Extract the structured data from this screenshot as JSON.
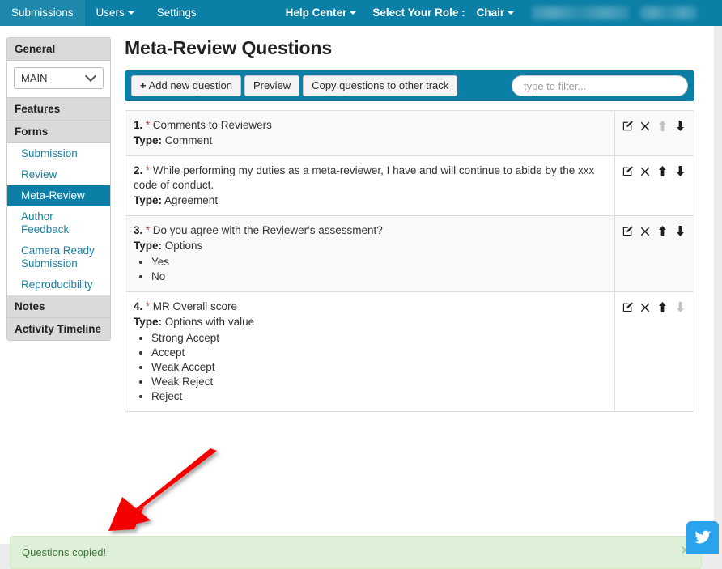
{
  "navbar": {
    "background": "#0b7fa5",
    "left_items": [
      {
        "label": "Submissions",
        "caret": false
      },
      {
        "label": "Users",
        "caret": true
      },
      {
        "label": "Settings",
        "caret": false
      }
    ],
    "help_center": "Help Center",
    "role_label": "Select Your Role :",
    "role_value": "Chair",
    "redacted_items": [
      "",
      ""
    ]
  },
  "sidebar": {
    "general_heading": "General",
    "track_select": {
      "value": "MAIN",
      "options": [
        "MAIN"
      ]
    },
    "features_heading": "Features",
    "forms_heading": "Forms",
    "forms_items": [
      {
        "label": "Submission",
        "active": false
      },
      {
        "label": "Review",
        "active": false
      },
      {
        "label": "Meta-Review",
        "active": true
      },
      {
        "label": "Author Feedback",
        "active": false
      },
      {
        "label": "Camera Ready Submission",
        "active": false
      },
      {
        "label": "Reproducibility",
        "active": false
      }
    ],
    "notes_heading": "Notes",
    "activity_heading": "Activity Timeline"
  },
  "main": {
    "title": "Meta-Review Questions",
    "toolbar": {
      "add_label": "Add new question",
      "add_plus": "+",
      "preview_label": "Preview",
      "copy_label": "Copy questions to other track",
      "filter_placeholder": "type to filter...",
      "filter_value": ""
    },
    "type_label": "Type:",
    "required_marker": "*",
    "questions": [
      {
        "number": "1.",
        "required": true,
        "text": "Comments to Reviewers",
        "type": "Comment",
        "options": [],
        "can_move_up": false,
        "can_move_down": true
      },
      {
        "number": "2.",
        "required": true,
        "text": "While performing my duties as a meta-reviewer, I have and will continue to abide by the xxx code of conduct.",
        "type": "Agreement",
        "options": [],
        "can_move_up": true,
        "can_move_down": true
      },
      {
        "number": "3.",
        "required": true,
        "text": "Do you agree with the Reviewer's assessment?",
        "type": "Options",
        "options": [
          "Yes",
          "No"
        ],
        "can_move_up": true,
        "can_move_down": true
      },
      {
        "number": "4.",
        "required": true,
        "text": "MR Overall score",
        "type": "Options with value",
        "options": [
          "Strong Accept",
          "Accept",
          "Weak Accept",
          "Weak Reject",
          "Reject"
        ],
        "can_move_up": true,
        "can_move_down": false
      }
    ],
    "row_actions": [
      {
        "name": "edit-icon",
        "title": "Edit"
      },
      {
        "name": "delete-icon",
        "title": "Delete"
      },
      {
        "name": "move-up-icon",
        "title": "Move up"
      },
      {
        "name": "move-down-icon",
        "title": "Move down"
      }
    ]
  },
  "alert": {
    "message": "Questions copied!",
    "close_label": "✕",
    "background": "#dff0d8",
    "text_color": "#3c763d"
  },
  "annotation": {
    "arrow_color": "#f50000"
  },
  "fab": {
    "icon": "twitter-icon",
    "color": "#2aa3ef"
  }
}
